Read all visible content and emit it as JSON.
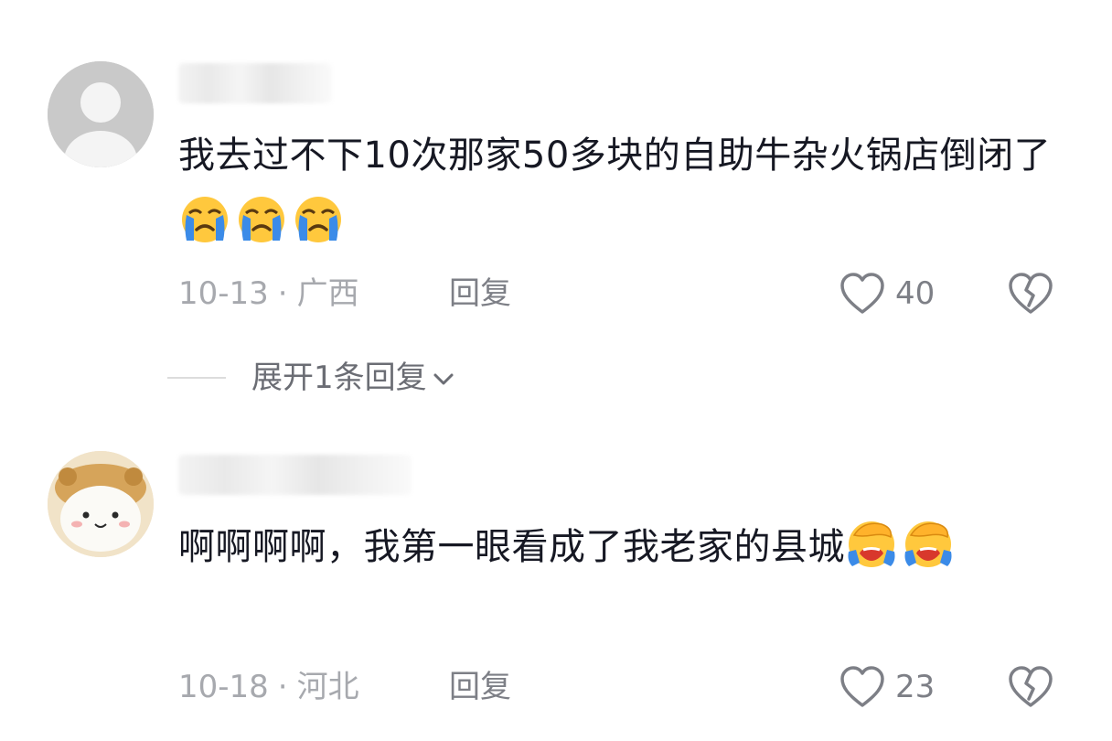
{
  "comments": [
    {
      "text": "我去过不下10次那家50多块的自助牛杂火锅店倒闭了",
      "emoji": [
        "loudly-crying",
        "loudly-crying",
        "loudly-crying"
      ],
      "date": "10-13",
      "location": "广西",
      "reply_label": "回复",
      "likes": "40"
    },
    {
      "text": "啊啊啊啊，我第一眼看成了我老家的县城",
      "emoji": [
        "facepalm-laugh",
        "facepalm-laugh"
      ],
      "date": "10-18",
      "location": "河北",
      "reply_label": "回复",
      "likes": "23"
    }
  ],
  "expand_replies_label": "展开1条回复",
  "meta_separator": "·",
  "colors": {
    "text_primary": "#161823",
    "text_meta": "#a7a9ae",
    "icon_stroke": "#7d7f86",
    "emoji_face": "#ffc83d"
  }
}
